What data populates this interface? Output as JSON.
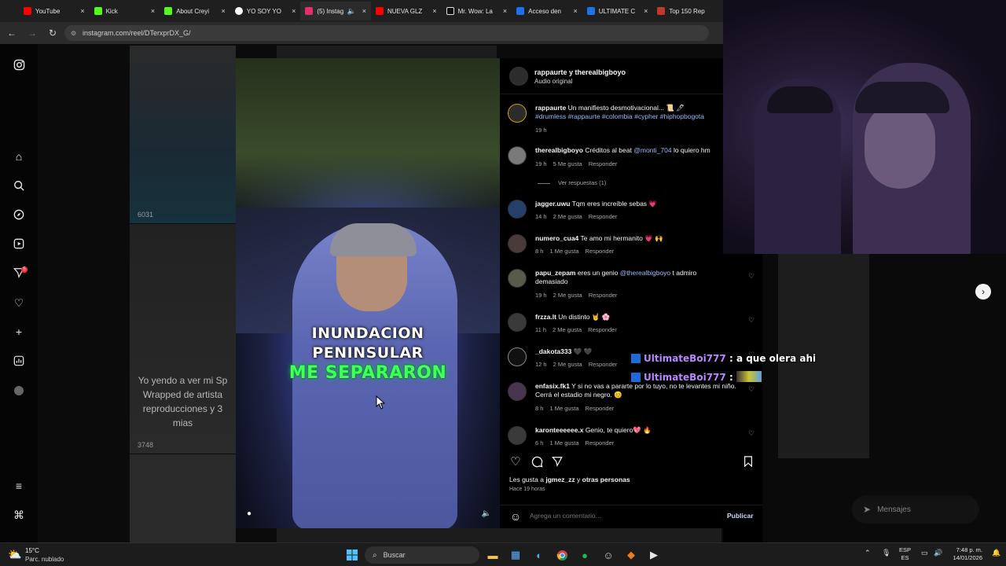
{
  "browser": {
    "tabs": [
      {
        "label": "YouTube",
        "color": "#ff0000"
      },
      {
        "label": "Kick",
        "color": "#53fc18"
      },
      {
        "label": "About Creyi",
        "color": "#53fc18"
      },
      {
        "label": "YO SOY YO",
        "color": "#ffffff"
      },
      {
        "label": "(5) Instag",
        "color": "#e1306c"
      },
      {
        "label": "NUEVA GLZ",
        "color": "#ff0000"
      },
      {
        "label": "Mr. Wow: La",
        "color": "#111111"
      },
      {
        "label": "Acceso den",
        "color": "#1a73e8"
      },
      {
        "label": "ULTIMATE C",
        "color": "#1a73e8"
      },
      {
        "label": "Top 150 Rep",
        "color": "#c0392b"
      }
    ],
    "tab_close": "×",
    "url": "instagram.com/reel/DTerxprDX_G/"
  },
  "sidebar": {
    "notifications_badge": "5"
  },
  "feed": {
    "tile1_views": "6031",
    "tile2_views": "3748",
    "tile2_caption": "Yo yendo a ver mi Sp Wrapped de artista reproducciones y 3 mias"
  },
  "video": {
    "line1": "INUNDACION",
    "line2": "PENINSULAR",
    "line3": "ME SEPARARON"
  },
  "reel": {
    "header_title": "rappaurte y therealbigboyo",
    "header_audio": "Audio original",
    "comments": [
      {
        "user": "rappaurte",
        "text": "Un manifiesto desmotivacional... 📜 🖊",
        "tags": "#drumless #rappaurte #colombia #cypher #hiphopbogota",
        "time": "19 h",
        "likes": "",
        "reply": ""
      },
      {
        "user": "therealbigboyo",
        "text": "Créditos al beat",
        "mention": "@monti_704",
        "text2": "lo quiero hm",
        "time": "19 h",
        "likes": "5 Me gusta",
        "reply": "Responder"
      },
      {
        "user": "jagger.uwu",
        "text": "Tqm eres increíble sebas 💗",
        "time": "14 h",
        "likes": "2 Me gusta",
        "reply": "Responder"
      },
      {
        "user": "numero_cua4",
        "text": "Te amo mi hermanito 💗 🙌",
        "time": "8 h",
        "likes": "1 Me gusta",
        "reply": "Responder"
      },
      {
        "user": "papu_zepam",
        "text": "eres un genio",
        "mention": "@therealbigboyo",
        "text2": "t admiro demasiado",
        "time": "19 h",
        "likes": "2 Me gusta",
        "reply": "Responder"
      },
      {
        "user": "frzza.lt",
        "text": "Un distinto 🤘 🌸",
        "time": "11 h",
        "likes": "2 Me gusta",
        "reply": "Responder"
      },
      {
        "user": "_dakota333",
        "text": "🖤 🖤",
        "time": "12 h",
        "likes": "2 Me gusta",
        "reply": "Responder"
      },
      {
        "user": "enfasix.fk1",
        "text": "Y si no vas a pararte por lo tuyo, no te levantes mi niño. Cerrá el estadio mi negro. 😊",
        "time": "8 h",
        "likes": "1 Me gusta",
        "reply": "Responder"
      },
      {
        "user": "karonteeeeee.x",
        "text": "Genio, te quiero💖 🔥",
        "time": "6 h",
        "likes": "1 Me gusta",
        "reply": "Responder"
      }
    ],
    "view_replies": "Ver respuestas (1)",
    "likes_prefix": "Les gusta a",
    "likes_user": "jgmez_zz",
    "likes_conj": "y",
    "likes_others": "otras personas",
    "posted_ago": "Hace 19 horas",
    "comment_placeholder": "Agrega un comentario...",
    "publish": "Publicar"
  },
  "chat": [
    {
      "name": "UltimateBoi777",
      "sep": ":",
      "msg": "a que olera ahi"
    },
    {
      "name": "UltimateBoi777",
      "sep": ":",
      "msg": ""
    }
  ],
  "messages_button": "Mensajes",
  "taskbar": {
    "temp": "15°C",
    "weather": "Parc. nublado",
    "search": "Buscar",
    "lang1": "ESP",
    "lang2": "ES",
    "time": "7:48 p. m.",
    "date": "14/01/2026"
  }
}
